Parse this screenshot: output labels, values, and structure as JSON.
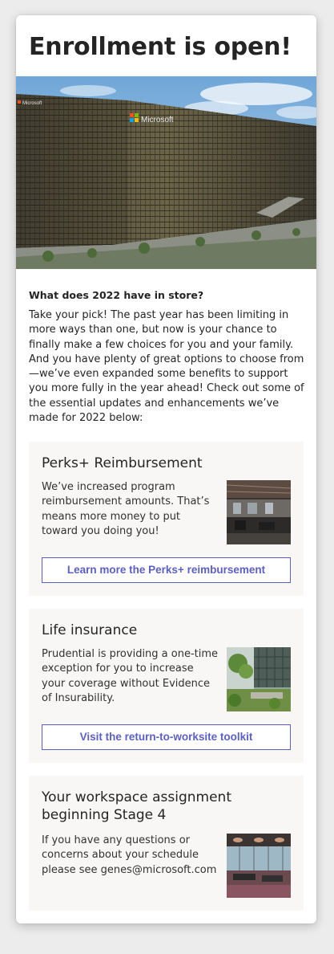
{
  "header": {
    "title": "Enrollment is open!"
  },
  "hero": {
    "brand": "Microsoft"
  },
  "intro": {
    "subheading": "What does 2022 have in store?",
    "body": "Take your pick! The past year has been limiting in more ways than one, but now is your chance to finally make a few choices for you and your family. And you have plenty of great options to choose from—we’ve even expanded some benefits to support you more fully in the year ahead! Check out some of the essential updates and enhancements we’ve made for 2022 below:"
  },
  "sections": [
    {
      "title": "Perks+ Reimbursement",
      "body": "We’ve increased program reimbursement amounts. That’s means more money to put toward you doing you!",
      "button_label": "Learn more the Perks+ reimbursement"
    },
    {
      "title": "Life insurance",
      "body": "Prudential is providing a one-time exception for you to increase your coverage without Evidence of Insurability.",
      "button_label": "Visit the return-to-worksite toolkit"
    },
    {
      "title": "Your workspace assignment beginning Stage 4",
      "body": "If you have any questions or concerns about your schedule please see genes@microsoft.com"
    }
  ],
  "colors": {
    "accent": "#5b5fc7",
    "section_background": "#f8f7f6",
    "page_background": "#ececec"
  }
}
